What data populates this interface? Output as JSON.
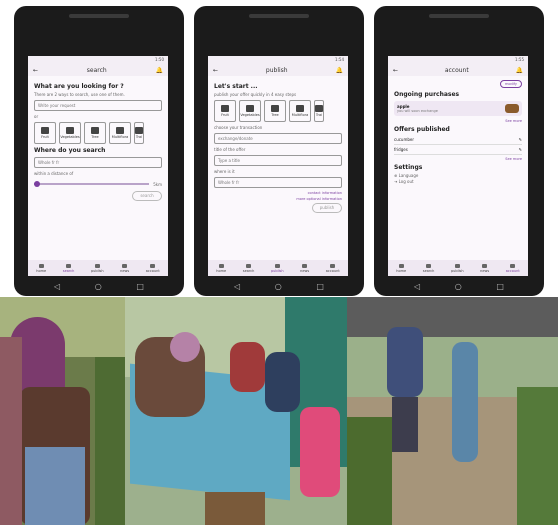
{
  "screens": [
    {
      "title": "search",
      "heading": "What are you looking for ?",
      "intro": "There are 2 ways to search, use one of them.",
      "input_placeholder": "Write your request",
      "or_label": "or",
      "categories": [
        "Fruit",
        "Vegetables",
        "Tree",
        "Multiflora",
        "Trai"
      ],
      "where_heading": "Where do you search",
      "where_value": "Whole fr fr",
      "distance_label": "within a distance of",
      "distance_value": "5km",
      "button_label": "search"
    },
    {
      "title": "publish",
      "heading": "Let's start ...",
      "intro": "publish your offer quickly in 4 easy steps",
      "categories": [
        "Fruit",
        "Vegetables",
        "Tree",
        "Multiflora",
        "Trai"
      ],
      "transaction_label": "choose your transaction",
      "transaction_value": "exchange/donate",
      "title_label": "title of the offer",
      "title_placeholder": "Type a title",
      "where_label": "where is it",
      "where_value": "Whole fr fr",
      "link1": "contact information",
      "link2": "more optional information",
      "button_label": "publish"
    },
    {
      "title": "account",
      "modify_label": "modify",
      "ongoing_heading": "Ongoing purchases",
      "ongoing_item": "apple",
      "ongoing_sub": "you will soon exchange",
      "see_more_1": "See more",
      "offers_heading": "Offers published",
      "offers": [
        "cucumber",
        "fridges"
      ],
      "see_more_2": "See more",
      "settings_heading": "Settings",
      "settings": [
        "Language",
        "Log out"
      ]
    }
  ],
  "nav_items": [
    "home",
    "search",
    "publish",
    "news",
    "account"
  ],
  "colors": {
    "accent": "#7b3fa0",
    "screen_bg": "#fbf8fc",
    "bar_bg": "#f3eef5"
  }
}
